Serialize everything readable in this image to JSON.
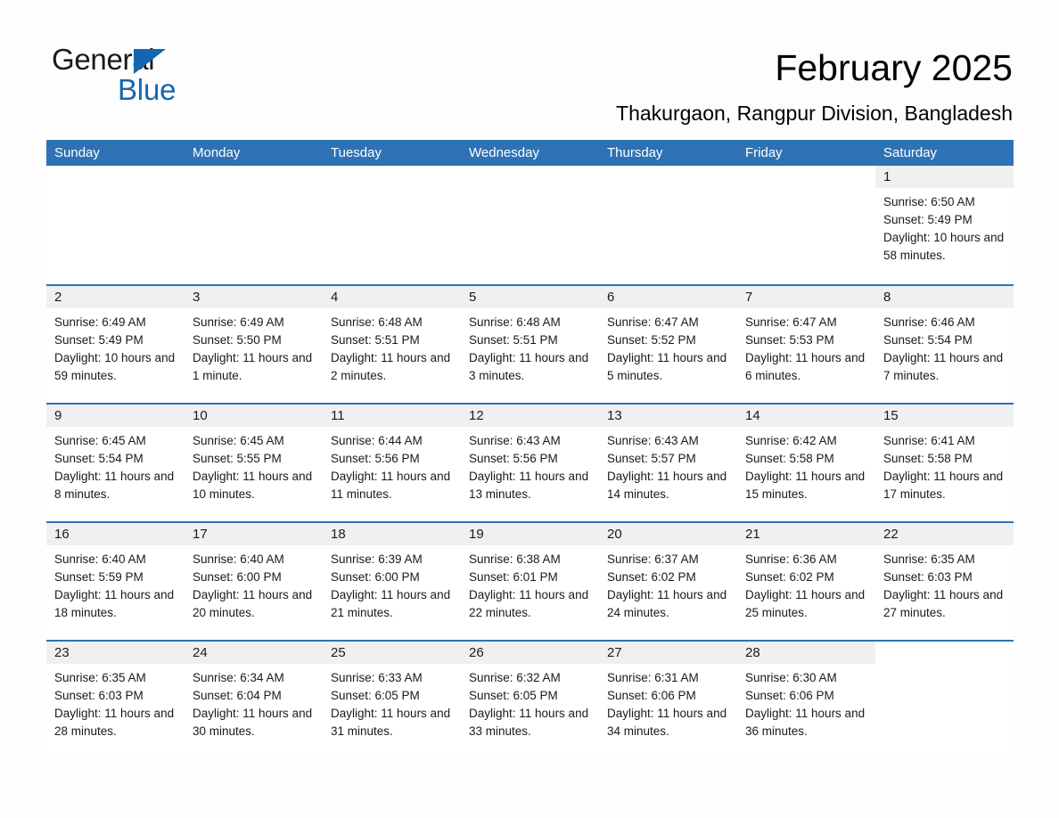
{
  "brand": {
    "name_part1": "General",
    "name_part2": "Blue",
    "triangle_color": "#1367b0",
    "text_color": "#1a1a1a"
  },
  "header": {
    "title": "February 2025",
    "subtitle": "Thakurgaon, Rangpur Division, Bangladesh",
    "accent_color": "#2e72b5",
    "band_color": "#f0f0f0"
  },
  "calendar": {
    "weekday_headers": [
      "Sunday",
      "Monday",
      "Tuesday",
      "Wednesday",
      "Thursday",
      "Friday",
      "Saturday"
    ],
    "weeks": [
      [
        {
          "day": "",
          "sunrise": "",
          "sunset": "",
          "daylight": "",
          "empty": true
        },
        {
          "day": "",
          "sunrise": "",
          "sunset": "",
          "daylight": "",
          "empty": true
        },
        {
          "day": "",
          "sunrise": "",
          "sunset": "",
          "daylight": "",
          "empty": true
        },
        {
          "day": "",
          "sunrise": "",
          "sunset": "",
          "daylight": "",
          "empty": true
        },
        {
          "day": "",
          "sunrise": "",
          "sunset": "",
          "daylight": "",
          "empty": true
        },
        {
          "day": "",
          "sunrise": "",
          "sunset": "",
          "daylight": "",
          "empty": true
        },
        {
          "day": "1",
          "sunrise": "Sunrise: 6:50 AM",
          "sunset": "Sunset: 5:49 PM",
          "daylight": "Daylight: 10 hours and 58 minutes.",
          "empty": false
        }
      ],
      [
        {
          "day": "2",
          "sunrise": "Sunrise: 6:49 AM",
          "sunset": "Sunset: 5:49 PM",
          "daylight": "Daylight: 10 hours and 59 minutes.",
          "empty": false
        },
        {
          "day": "3",
          "sunrise": "Sunrise: 6:49 AM",
          "sunset": "Sunset: 5:50 PM",
          "daylight": "Daylight: 11 hours and 1 minute.",
          "empty": false
        },
        {
          "day": "4",
          "sunrise": "Sunrise: 6:48 AM",
          "sunset": "Sunset: 5:51 PM",
          "daylight": "Daylight: 11 hours and 2 minutes.",
          "empty": false
        },
        {
          "day": "5",
          "sunrise": "Sunrise: 6:48 AM",
          "sunset": "Sunset: 5:51 PM",
          "daylight": "Daylight: 11 hours and 3 minutes.",
          "empty": false
        },
        {
          "day": "6",
          "sunrise": "Sunrise: 6:47 AM",
          "sunset": "Sunset: 5:52 PM",
          "daylight": "Daylight: 11 hours and 5 minutes.",
          "empty": false
        },
        {
          "day": "7",
          "sunrise": "Sunrise: 6:47 AM",
          "sunset": "Sunset: 5:53 PM",
          "daylight": "Daylight: 11 hours and 6 minutes.",
          "empty": false
        },
        {
          "day": "8",
          "sunrise": "Sunrise: 6:46 AM",
          "sunset": "Sunset: 5:54 PM",
          "daylight": "Daylight: 11 hours and 7 minutes.",
          "empty": false
        }
      ],
      [
        {
          "day": "9",
          "sunrise": "Sunrise: 6:45 AM",
          "sunset": "Sunset: 5:54 PM",
          "daylight": "Daylight: 11 hours and 8 minutes.",
          "empty": false
        },
        {
          "day": "10",
          "sunrise": "Sunrise: 6:45 AM",
          "sunset": "Sunset: 5:55 PM",
          "daylight": "Daylight: 11 hours and 10 minutes.",
          "empty": false
        },
        {
          "day": "11",
          "sunrise": "Sunrise: 6:44 AM",
          "sunset": "Sunset: 5:56 PM",
          "daylight": "Daylight: 11 hours and 11 minutes.",
          "empty": false
        },
        {
          "day": "12",
          "sunrise": "Sunrise: 6:43 AM",
          "sunset": "Sunset: 5:56 PM",
          "daylight": "Daylight: 11 hours and 13 minutes.",
          "empty": false
        },
        {
          "day": "13",
          "sunrise": "Sunrise: 6:43 AM",
          "sunset": "Sunset: 5:57 PM",
          "daylight": "Daylight: 11 hours and 14 minutes.",
          "empty": false
        },
        {
          "day": "14",
          "sunrise": "Sunrise: 6:42 AM",
          "sunset": "Sunset: 5:58 PM",
          "daylight": "Daylight: 11 hours and 15 minutes.",
          "empty": false
        },
        {
          "day": "15",
          "sunrise": "Sunrise: 6:41 AM",
          "sunset": "Sunset: 5:58 PM",
          "daylight": "Daylight: 11 hours and 17 minutes.",
          "empty": false
        }
      ],
      [
        {
          "day": "16",
          "sunrise": "Sunrise: 6:40 AM",
          "sunset": "Sunset: 5:59 PM",
          "daylight": "Daylight: 11 hours and 18 minutes.",
          "empty": false
        },
        {
          "day": "17",
          "sunrise": "Sunrise: 6:40 AM",
          "sunset": "Sunset: 6:00 PM",
          "daylight": "Daylight: 11 hours and 20 minutes.",
          "empty": false
        },
        {
          "day": "18",
          "sunrise": "Sunrise: 6:39 AM",
          "sunset": "Sunset: 6:00 PM",
          "daylight": "Daylight: 11 hours and 21 minutes.",
          "empty": false
        },
        {
          "day": "19",
          "sunrise": "Sunrise: 6:38 AM",
          "sunset": "Sunset: 6:01 PM",
          "daylight": "Daylight: 11 hours and 22 minutes.",
          "empty": false
        },
        {
          "day": "20",
          "sunrise": "Sunrise: 6:37 AM",
          "sunset": "Sunset: 6:02 PM",
          "daylight": "Daylight: 11 hours and 24 minutes.",
          "empty": false
        },
        {
          "day": "21",
          "sunrise": "Sunrise: 6:36 AM",
          "sunset": "Sunset: 6:02 PM",
          "daylight": "Daylight: 11 hours and 25 minutes.",
          "empty": false
        },
        {
          "day": "22",
          "sunrise": "Sunrise: 6:35 AM",
          "sunset": "Sunset: 6:03 PM",
          "daylight": "Daylight: 11 hours and 27 minutes.",
          "empty": false
        }
      ],
      [
        {
          "day": "23",
          "sunrise": "Sunrise: 6:35 AM",
          "sunset": "Sunset: 6:03 PM",
          "daylight": "Daylight: 11 hours and 28 minutes.",
          "empty": false
        },
        {
          "day": "24",
          "sunrise": "Sunrise: 6:34 AM",
          "sunset": "Sunset: 6:04 PM",
          "daylight": "Daylight: 11 hours and 30 minutes.",
          "empty": false
        },
        {
          "day": "25",
          "sunrise": "Sunrise: 6:33 AM",
          "sunset": "Sunset: 6:05 PM",
          "daylight": "Daylight: 11 hours and 31 minutes.",
          "empty": false
        },
        {
          "day": "26",
          "sunrise": "Sunrise: 6:32 AM",
          "sunset": "Sunset: 6:05 PM",
          "daylight": "Daylight: 11 hours and 33 minutes.",
          "empty": false
        },
        {
          "day": "27",
          "sunrise": "Sunrise: 6:31 AM",
          "sunset": "Sunset: 6:06 PM",
          "daylight": "Daylight: 11 hours and 34 minutes.",
          "empty": false
        },
        {
          "day": "28",
          "sunrise": "Sunrise: 6:30 AM",
          "sunset": "Sunset: 6:06 PM",
          "daylight": "Daylight: 11 hours and 36 minutes.",
          "empty": false
        },
        {
          "day": "",
          "sunrise": "",
          "sunset": "",
          "daylight": "",
          "empty": true
        }
      ]
    ]
  }
}
